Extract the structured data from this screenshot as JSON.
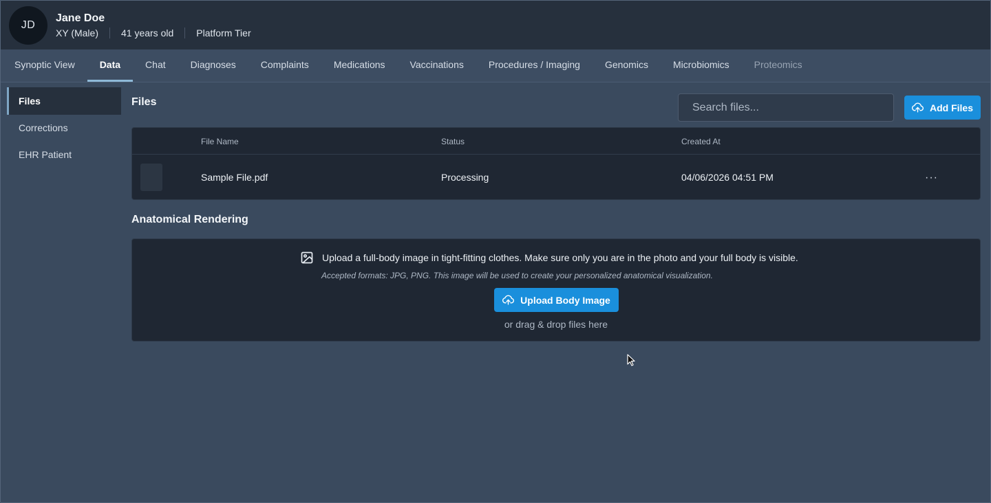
{
  "patient": {
    "initials": "JD",
    "name": "Jane Doe",
    "sex": "XY (Male)",
    "age": "41 years old",
    "tier": "Platform Tier"
  },
  "tabs": [
    {
      "label": "Synoptic View",
      "state": "normal"
    },
    {
      "label": "Data",
      "state": "active"
    },
    {
      "label": "Chat",
      "state": "normal"
    },
    {
      "label": "Diagnoses",
      "state": "normal"
    },
    {
      "label": "Complaints",
      "state": "normal"
    },
    {
      "label": "Medications",
      "state": "normal"
    },
    {
      "label": "Vaccinations",
      "state": "normal"
    },
    {
      "label": "Procedures / Imaging",
      "state": "normal"
    },
    {
      "label": "Genomics",
      "state": "normal"
    },
    {
      "label": "Microbiomics",
      "state": "normal"
    },
    {
      "label": "Proteomics",
      "state": "disabled"
    }
  ],
  "sidebar": {
    "items": [
      {
        "label": "Files",
        "active": true
      },
      {
        "label": "Corrections",
        "active": false
      },
      {
        "label": "EHR Patient",
        "active": false
      }
    ]
  },
  "files": {
    "title": "Files",
    "search_placeholder": "Search files...",
    "add_label": "Add Files",
    "columns": [
      "File Name",
      "Status",
      "Created At"
    ],
    "rows": [
      {
        "name": "Sample File.pdf",
        "status": "Processing",
        "created_at": "04/06/2026 04:51 PM",
        "menu": "···"
      }
    ]
  },
  "anatomical": {
    "title": "Anatomical Rendering",
    "instruction": "Upload a full-body image in tight-fitting clothes. Make sure only you are in the photo and your full body is visible.",
    "hint": "Accepted formats: JPG, PNG. This image will be used to create your personalized anatomical visualization.",
    "button_label": "Upload Body Image",
    "drag_text": "or drag & drop files here"
  },
  "colors": {
    "accent": "#1a8fdc",
    "background": "#3a4a5e",
    "header": "#26303d",
    "panel": "#1f2733"
  }
}
